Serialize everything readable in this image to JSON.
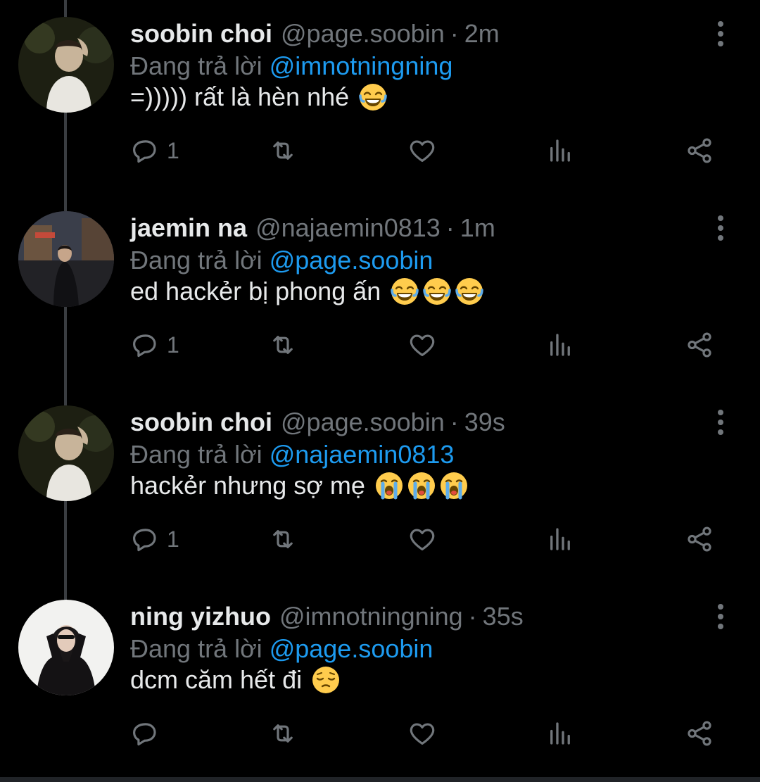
{
  "reply_prefix": "Đang trả lời",
  "tweets": [
    {
      "name": "soobin choi",
      "handle": "@page.soobin",
      "sep": "·",
      "time": "2m",
      "mention": "@imnotningning",
      "text": "=))))) rất là hèn nhé",
      "emoji": [
        "face-with-tears-of-joy"
      ],
      "reply_count": "1"
    },
    {
      "name": "jaemin na",
      "handle": "@najaemin0813",
      "sep": "·",
      "time": "1m",
      "mention": "@page.soobin",
      "text": "ed hackẻr bị phong ấn",
      "emoji": [
        "face-with-tears-of-joy",
        "face-with-tears-of-joy",
        "face-with-tears-of-joy"
      ],
      "reply_count": "1"
    },
    {
      "name": "soobin choi",
      "handle": "@page.soobin",
      "sep": "·",
      "time": "39s",
      "mention": "@najaemin0813",
      "text": "hackẻr nhưng sợ mẹ",
      "emoji": [
        "loudly-crying-face",
        "loudly-crying-face",
        "loudly-crying-face"
      ],
      "reply_count": "1"
    },
    {
      "name": "ning yizhuo",
      "handle": "@imnotningning",
      "sep": "·",
      "time": "35s",
      "mention": "@page.soobin",
      "text": "dcm căm hết đi",
      "emoji": [
        "pensive-face"
      ],
      "reply_count": ""
    }
  ],
  "icons": {
    "reply": "speech-bubble-icon",
    "retweet": "retweet-icon",
    "like": "heart-icon",
    "views": "analytics-icon",
    "share": "share-icon",
    "more": "vertical-ellipsis-icon"
  },
  "colors": {
    "background": "#000000",
    "text": "#e7e9ea",
    "muted": "#71767b",
    "mention": "#1d9bf0",
    "thread_line": "#3a3d41"
  }
}
